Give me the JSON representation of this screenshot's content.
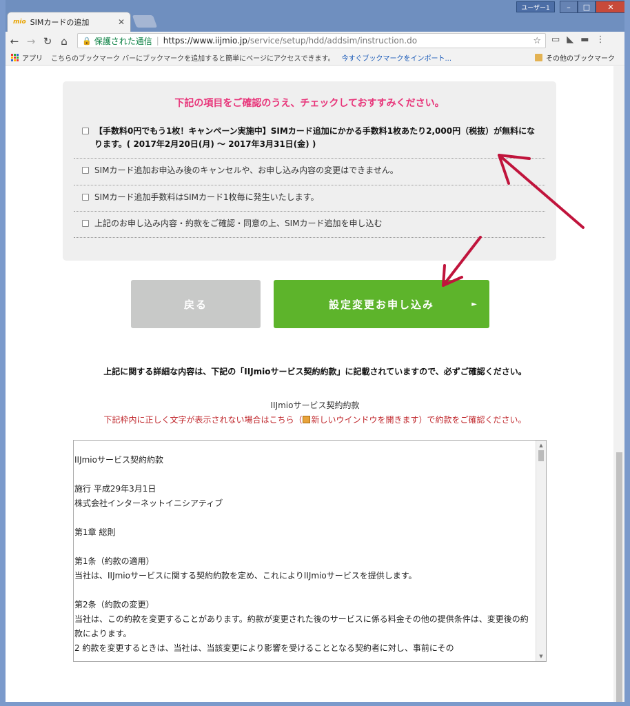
{
  "browser": {
    "tab_title": "SIMカードの追加",
    "tab_favicon_text": "mio",
    "user_label": "ユーザー1",
    "secure_label": "保護された通信",
    "url_host": "https://www.iijmio.jp",
    "url_path": "/service/setup/hdd/addsim/instruction.do",
    "bookmarks": {
      "apps_label": "アプリ",
      "hint": "こちらのブックマーク バーにブックマークを追加すると簡単にページにアクセスできます。",
      "import_link": "今すぐブックマークをインポート...",
      "other_label": "その他のブックマーク"
    }
  },
  "confirm": {
    "heading": "下記の項目をご確認のうえ、チェックしておすすみください。",
    "items": [
      {
        "text": "【手数料0円でもう1枚！キャンペーン実施中】SIMカード追加にかかる手数料1枚あたり2,000円（税抜）が無料になります。( 2017年2月20日(月) 〜 2017年3月31日(金) )"
      },
      {
        "text": "SIMカード追加お申込み後のキャンセルや、お申し込み内容の変更はできません。"
      },
      {
        "text": "SIMカード追加手数料はSIMカード1枚毎に発生いたします。"
      },
      {
        "text": "上記のお申し込み内容・約款をご確認・同意の上、SIMカード追加を申し込む"
      }
    ]
  },
  "buttons": {
    "back": "戻る",
    "submit": "設定変更お申し込み",
    "submit_arrow": "►"
  },
  "notice": "上記に関する詳細な内容は、下記の「IIJmioサービス契約約款」に記載されていますので、必ずご確認ください。",
  "terms": {
    "title": "IIJmioサービス契約約款",
    "warning_pre": "下記枠内に正しく文字が表示されない場合は",
    "warning_link": "こちら",
    "warning_newwin": "新しいウインドウを開きます",
    "warning_post": "で約款をご確認ください。",
    "body": "IIJmioサービス契約約款\n\n施行 平成29年3月1日\n株式会社インターネットイニシアティブ\n\n第1章 総則\n\n第1条（約款の適用）\n当社は、IIJmioサービスに関する契約約款を定め、これによりIIJmioサービスを提供します。\n\n第2条（約款の変更）\n当社は、この約款を変更することがあります。約款が変更された後のサービスに係る料金その他の提供条件は、変更後の約款によります。\n2 約款を変更するときは、当社は、当該変更により影響を受けることとなる契約者に対し、事前にその"
  },
  "colors": {
    "heading_pink": "#e8357a",
    "submit_green": "#5db42b",
    "back_gray": "#c8c9c8",
    "warning_red": "#c0282d",
    "annotation_arrow": "#c0143c"
  }
}
